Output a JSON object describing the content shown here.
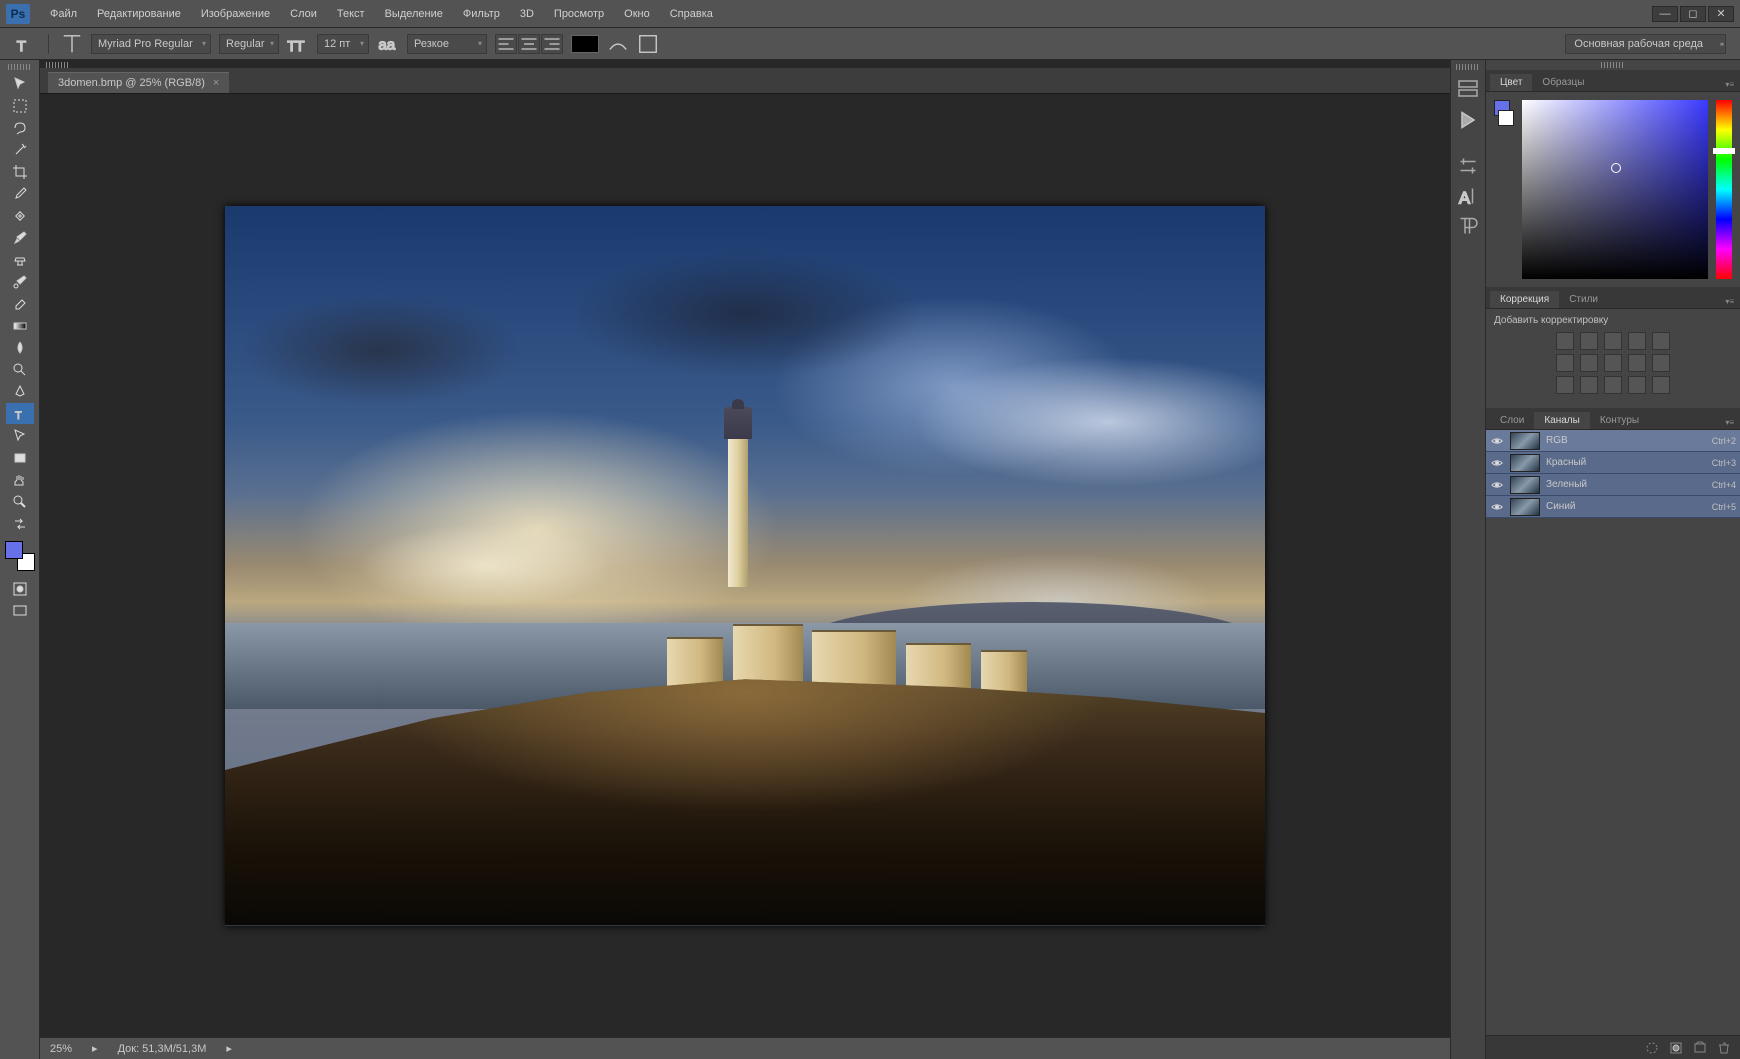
{
  "app": {
    "logo": "Ps"
  },
  "menu": [
    "Файл",
    "Редактирование",
    "Изображение",
    "Слои",
    "Текст",
    "Выделение",
    "Фильтр",
    "3D",
    "Просмотр",
    "Окно",
    "Справка"
  ],
  "options": {
    "font": "Myriad Pro Regular",
    "weight": "Regular",
    "size": "12 пт",
    "aa": "Резкое",
    "workspace": "Основная рабочая среда"
  },
  "document": {
    "tab": "3domen.bmp @ 25% (RGB/8)",
    "zoom": "25%",
    "docinfo": "Док: 51,3M/51,3M"
  },
  "panels": {
    "color_tabs": [
      "Цвет",
      "Образцы"
    ],
    "adjust_tabs": [
      "Коррекция",
      "Стили"
    ],
    "adjust_label": "Добавить корректировку",
    "channel_tabs": [
      "Слои",
      "Каналы",
      "Контуры"
    ],
    "channels": [
      {
        "name": "RGB",
        "key": "Ctrl+2"
      },
      {
        "name": "Красный",
        "key": "Ctrl+3"
      },
      {
        "name": "Зеленый",
        "key": "Ctrl+4"
      },
      {
        "name": "Синий",
        "key": "Ctrl+5"
      }
    ]
  }
}
